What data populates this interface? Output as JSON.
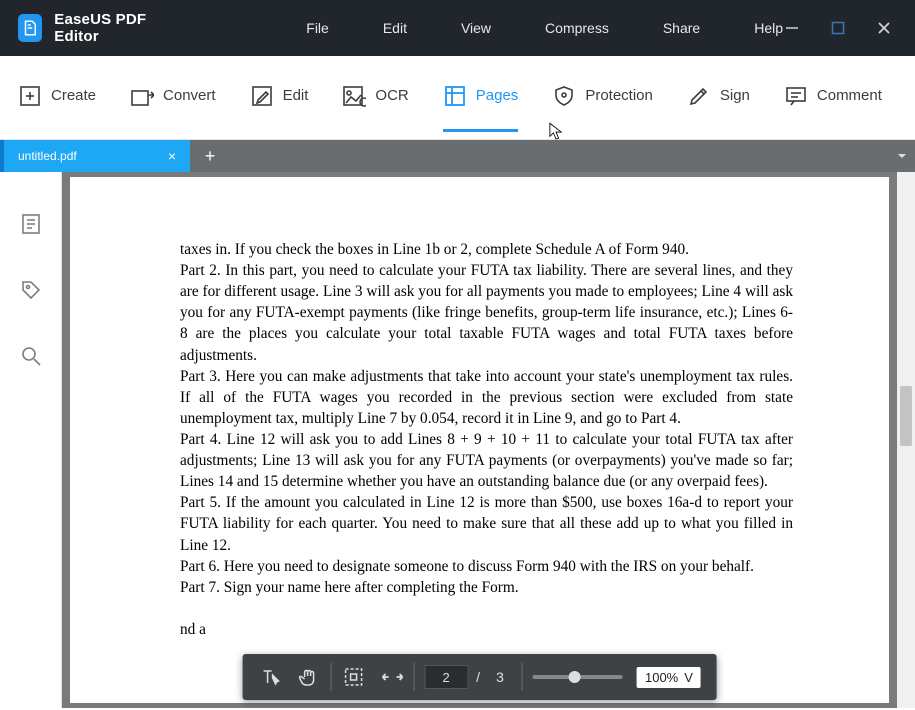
{
  "app": {
    "title": "EaseUS PDF Editor"
  },
  "menu": [
    "File",
    "Edit",
    "View",
    "Compress",
    "Share",
    "Help"
  ],
  "toolbar": [
    {
      "label": "Create",
      "icon": "plus-box",
      "active": false
    },
    {
      "label": "Convert",
      "icon": "convert",
      "active": false
    },
    {
      "label": "Edit",
      "icon": "pencil-box",
      "active": false
    },
    {
      "label": "OCR",
      "icon": "ocr",
      "active": false
    },
    {
      "label": "Pages",
      "icon": "pages",
      "active": true
    },
    {
      "label": "Protection",
      "icon": "shield",
      "active": false
    },
    {
      "label": "Sign",
      "icon": "pen",
      "active": false
    },
    {
      "label": "Comment",
      "icon": "comment",
      "active": false
    }
  ],
  "tab": {
    "name": "untitled.pdf"
  },
  "document": {
    "body": "taxes in. If you check the boxes in Line 1b or 2, complete Schedule A of Form 940.\nPart 2. In this part, you need to calculate your FUTA tax liability. There are several lines, and they are for different usage. Line 3 will ask you for all payments you made to employees; Line 4 will ask you for any FUTA-exempt payments (like fringe benefits, group-term life insurance, etc.); Lines 6-8 are the places you calculate your total taxable FUTA wages and total FUTA taxes before adjustments.\nPart 3. Here you can make adjustments that take into account your state's unemployment tax rules. If all of the FUTA wages you recorded in the previous section were excluded from state unemployment tax, multiply Line 7 by 0.054, record it in Line 9, and go to Part 4.\nPart 4. Line 12 will ask you to add Lines 8 + 9 + 10 + 11 to calculate your total FUTA tax after adjustments; Line 13 will ask you for any FUTA payments (or overpayments) you've made so far; Lines 14 and 15 determine whether you have an outstanding balance due (or any overpaid fees).\nPart 5. If the amount you calculated in Line 12 is more than $500, use boxes 16a-d to report your FUTA liability for each quarter. You need to make sure that all these add up to what you filled in Line 12.\nPart 6. Here you need to designate someone to discuss Form 940 with the IRS on your behalf.\nPart 7. Sign your name here after completing the Form.\n\nnd a"
  },
  "zoombar": {
    "page_current": "2",
    "page_sep": "/",
    "page_total": "3",
    "zoom": "100%"
  }
}
